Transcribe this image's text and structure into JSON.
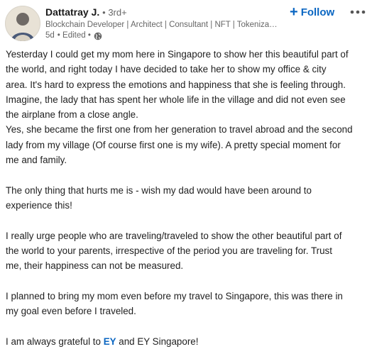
{
  "author": {
    "name": "Dattatray J.",
    "degree": "• 3rd+",
    "headline": "Blockchain Developer | Architect | Consultant | NFT | Tokenization",
    "time": "5d",
    "edited": "• Edited •"
  },
  "actions": {
    "follow_label": "Follow",
    "follow_icon": "+"
  },
  "icons": {
    "avatar": "avatar-icon",
    "globe": "globe-icon",
    "more": "more-options-icon"
  },
  "colors": {
    "accent": "#0a66c2",
    "text": "#1f1f1f",
    "muted": "#666666"
  },
  "post": {
    "line1": "Yesterday I could get my mom here in Singapore to show her this beautiful part of",
    "line2": "the world, and right today I have decided to take her to show my office & city",
    "line3": "area. It's hard to express the emotions and happiness that she is feeling through.",
    "line4": "Imagine, the lady that has spent her whole life in the village and did not even see",
    "line5": "the airplane from a close angle.",
    "line6": "Yes, she became the first one from her generation to travel abroad and the second",
    "line7": "lady from my village (Of course first one is my wife). A pretty special moment for",
    "line8": "me and family.",
    "line9": "The only thing that hurts me is - wish my dad would have been around to",
    "line10": "experience this!",
    "line11": "I really urge people who are traveling/traveled to show the other beautiful part of",
    "line12": "the world to your parents, irrespective of the period you are traveling for. Trust",
    "line13": "me, their happiness can not be measured.",
    "line14": "I planned to bring my mom even before my travel to Singapore, this was there in",
    "line15": "my goal even before I traveled.",
    "last_prefix": "I am always grateful to ",
    "mention": "EY",
    "last_suffix": " and EY Singapore!"
  }
}
